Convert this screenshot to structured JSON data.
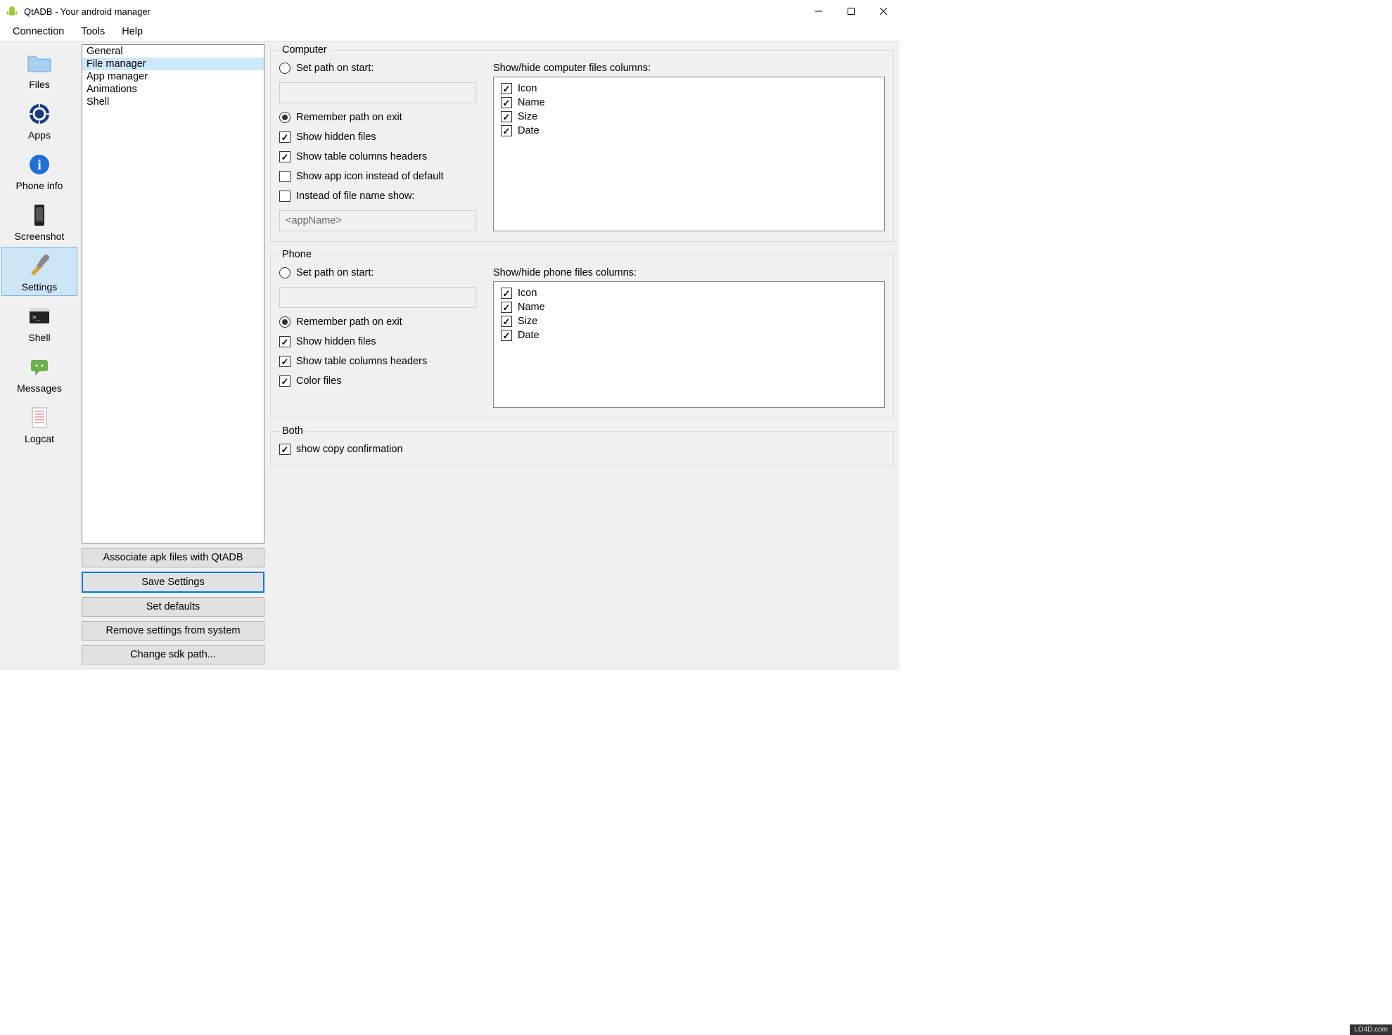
{
  "titlebar": {
    "title": "QtADB - Your android manager"
  },
  "menubar": {
    "items": [
      "Connection",
      "Tools",
      "Help"
    ]
  },
  "sidebar": {
    "items": [
      {
        "label": "Files"
      },
      {
        "label": "Apps"
      },
      {
        "label": "Phone info"
      },
      {
        "label": "Screenshot"
      },
      {
        "label": "Settings",
        "selected": true
      },
      {
        "label": "Shell"
      },
      {
        "label": "Messages"
      },
      {
        "label": "Logcat"
      }
    ]
  },
  "categories": {
    "items": [
      "General",
      "File manager",
      "App manager",
      "Animations",
      "Shell"
    ],
    "selected": "File manager"
  },
  "buttons": {
    "associate": "Associate apk files with QtADB",
    "save": "Save Settings",
    "defaults": "Set defaults",
    "remove": "Remove settings from system",
    "sdk": "Change sdk path..."
  },
  "computer": {
    "legend": "Computer",
    "set_path_label": "Set path on start:",
    "set_path_value": "",
    "remember_label": "Remember path on exit",
    "hidden_label": "Show hidden files",
    "headers_label": "Show table columns headers",
    "appicon_label": "Show app icon instead of default",
    "instead_label": "Instead of file name show:",
    "instead_value": "<appName>",
    "cols_label": "Show/hide computer files columns:",
    "cols": [
      "Icon",
      "Name",
      "Size",
      "Date"
    ],
    "path_mode": "remember",
    "hidden_checked": true,
    "headers_checked": true,
    "appicon_checked": false,
    "instead_checked": false
  },
  "phone": {
    "legend": "Phone",
    "set_path_label": "Set path on start:",
    "set_path_value": "",
    "remember_label": "Remember path on exit",
    "hidden_label": "Show hidden files",
    "headers_label": "Show table columns headers",
    "color_label": "Color files",
    "cols_label": "Show/hide phone files columns:",
    "cols": [
      "Icon",
      "Name",
      "Size",
      "Date"
    ],
    "path_mode": "remember",
    "hidden_checked": true,
    "headers_checked": true,
    "color_checked": true
  },
  "both": {
    "legend": "Both",
    "copy_label": "show copy confirmation",
    "copy_checked": true
  },
  "watermark": "LO4D.com"
}
